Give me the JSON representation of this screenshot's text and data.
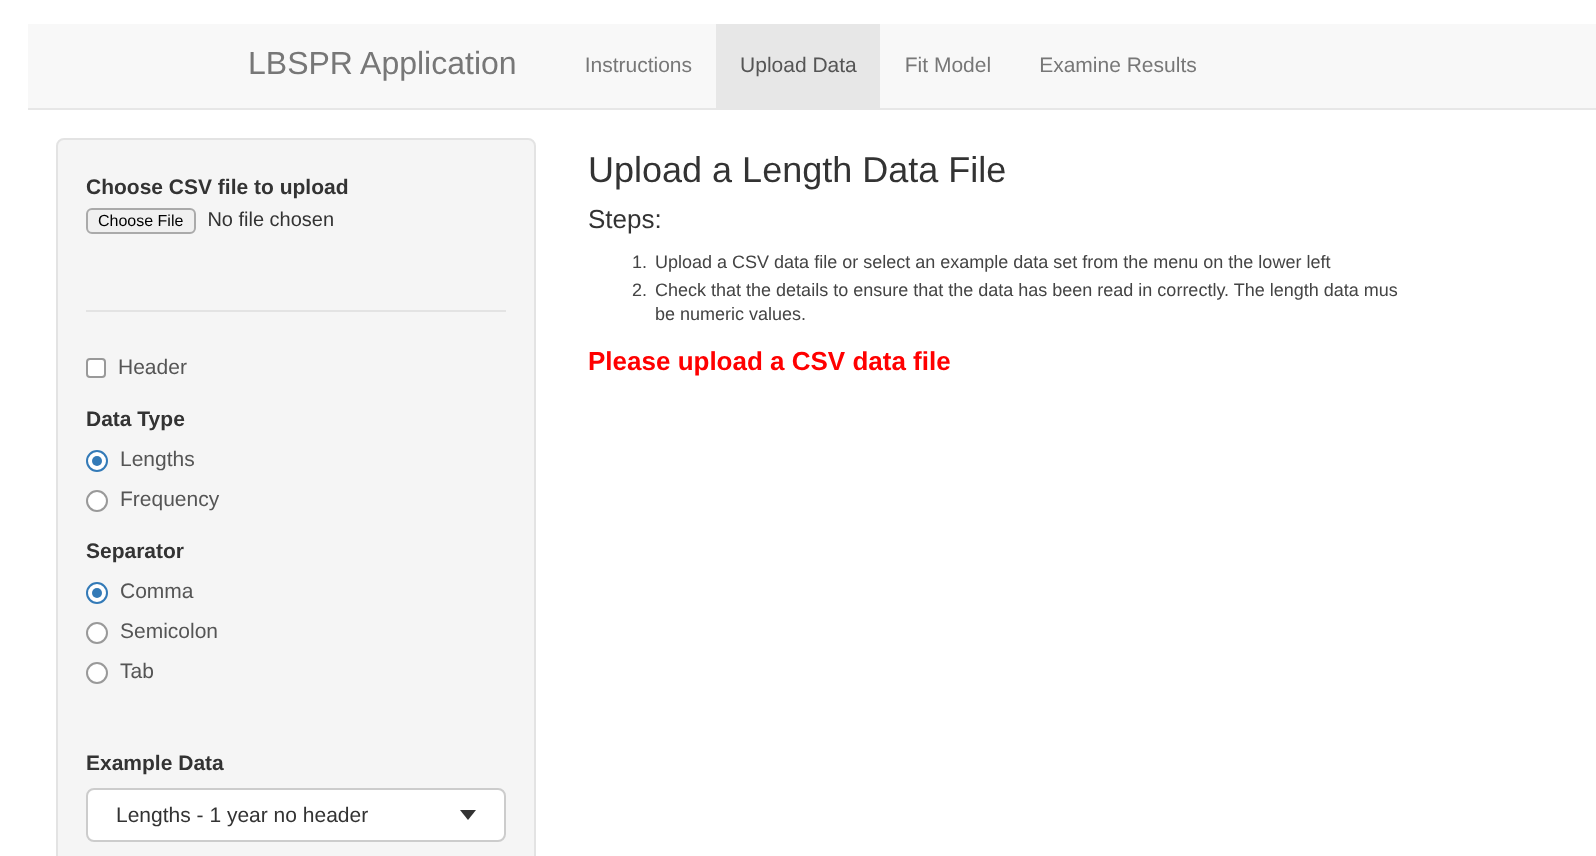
{
  "navbar": {
    "brand": "LBSPR Application",
    "tabs": [
      {
        "label": "Instructions",
        "selected": false
      },
      {
        "label": "Upload Data",
        "selected": true
      },
      {
        "label": "Fit Model",
        "selected": false
      },
      {
        "label": "Examine Results",
        "selected": false
      }
    ]
  },
  "sidebar": {
    "file_input": {
      "label": "Choose CSV file to upload",
      "button": "Choose File",
      "status": "No file chosen"
    },
    "header_checkbox": {
      "label": "Header",
      "checked": false
    },
    "groups": [
      {
        "title": "Data Type",
        "options": [
          {
            "label": "Lengths",
            "selected": true
          },
          {
            "label": "Frequency",
            "selected": false
          }
        ]
      },
      {
        "title": "Separator",
        "options": [
          {
            "label": "Comma",
            "selected": true
          },
          {
            "label": "Semicolon",
            "selected": false
          },
          {
            "label": "Tab",
            "selected": false
          }
        ]
      }
    ],
    "example_data": {
      "label": "Example Data",
      "value": "Lengths - 1 year no header"
    }
  },
  "main": {
    "title": "Upload a Length Data File",
    "subtitle": "Steps:",
    "steps": [
      {
        "number": "1.",
        "lines": [
          "Upload a CSV data file or select an example data set from the menu on the lower left"
        ]
      },
      {
        "number": "2.",
        "lines": [
          "Check that the details to ensure that the data has been read in correctly. The length data mus",
          "be numeric values."
        ]
      }
    ],
    "message": "Please upload a CSV data file"
  }
}
